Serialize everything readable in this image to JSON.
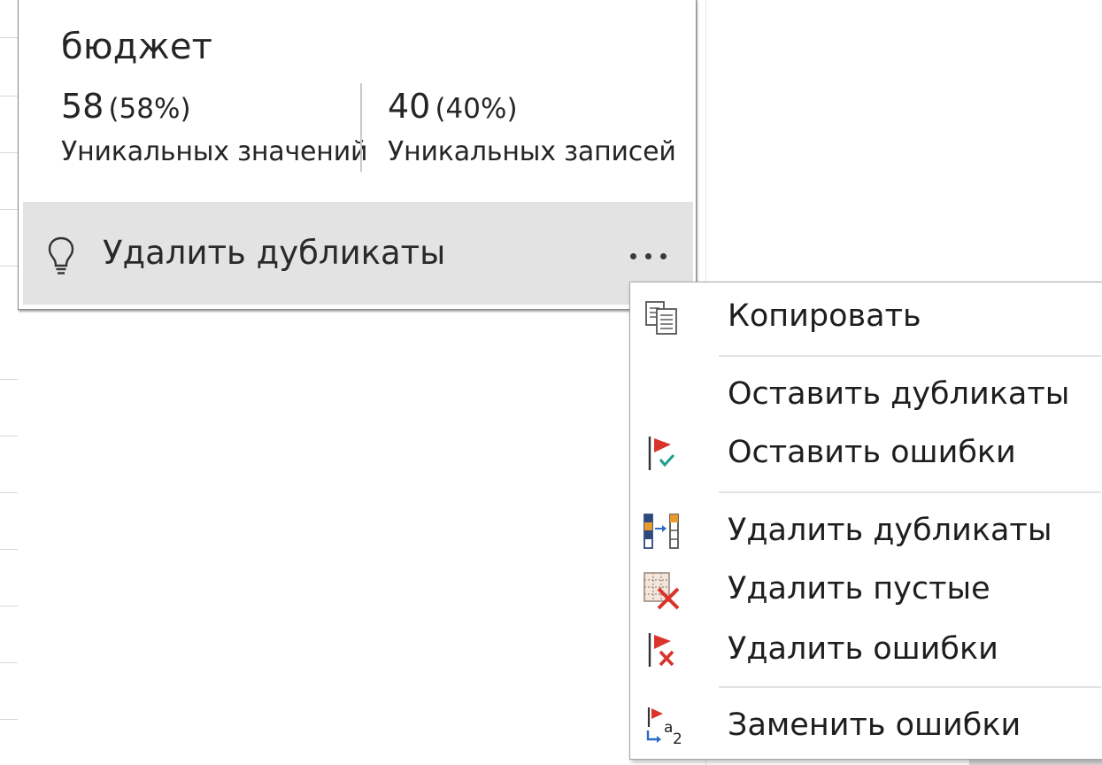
{
  "card": {
    "title": "бюджет",
    "stats": [
      {
        "value": "58",
        "percent": "(58%)",
        "label": "Уникальных значений"
      },
      {
        "value": "40",
        "percent": "(40%)",
        "label": "Уникальных записей"
      }
    ],
    "action": {
      "icon": "lightbulb-icon",
      "label": "Удалить дубликаты"
    },
    "more_icon": "ellipsis-icon"
  },
  "menu": {
    "items": [
      {
        "icon": "copy-icon",
        "label": "Копировать"
      },
      {
        "icon": "",
        "label": "Оставить дубликаты"
      },
      {
        "icon": "keep-errors-icon",
        "label": "Оставить ошибки"
      },
      {
        "icon": "remove-duplicates-icon",
        "label": "Удалить дубликаты"
      },
      {
        "icon": "remove-empty-icon",
        "label": "Удалить пустые"
      },
      {
        "icon": "remove-errors-icon",
        "label": "Удалить ошибки"
      },
      {
        "icon": "replace-errors-icon",
        "label": "Заменить ошибки"
      }
    ]
  },
  "colors": {
    "action_bar": "#e3e3e3",
    "flag_red": "#d9342b",
    "check_teal": "#1f9e8f",
    "arrow_blue": "#2b6cc4",
    "bar_orange": "#e89a2c",
    "bar_navy": "#2e4a7d"
  }
}
